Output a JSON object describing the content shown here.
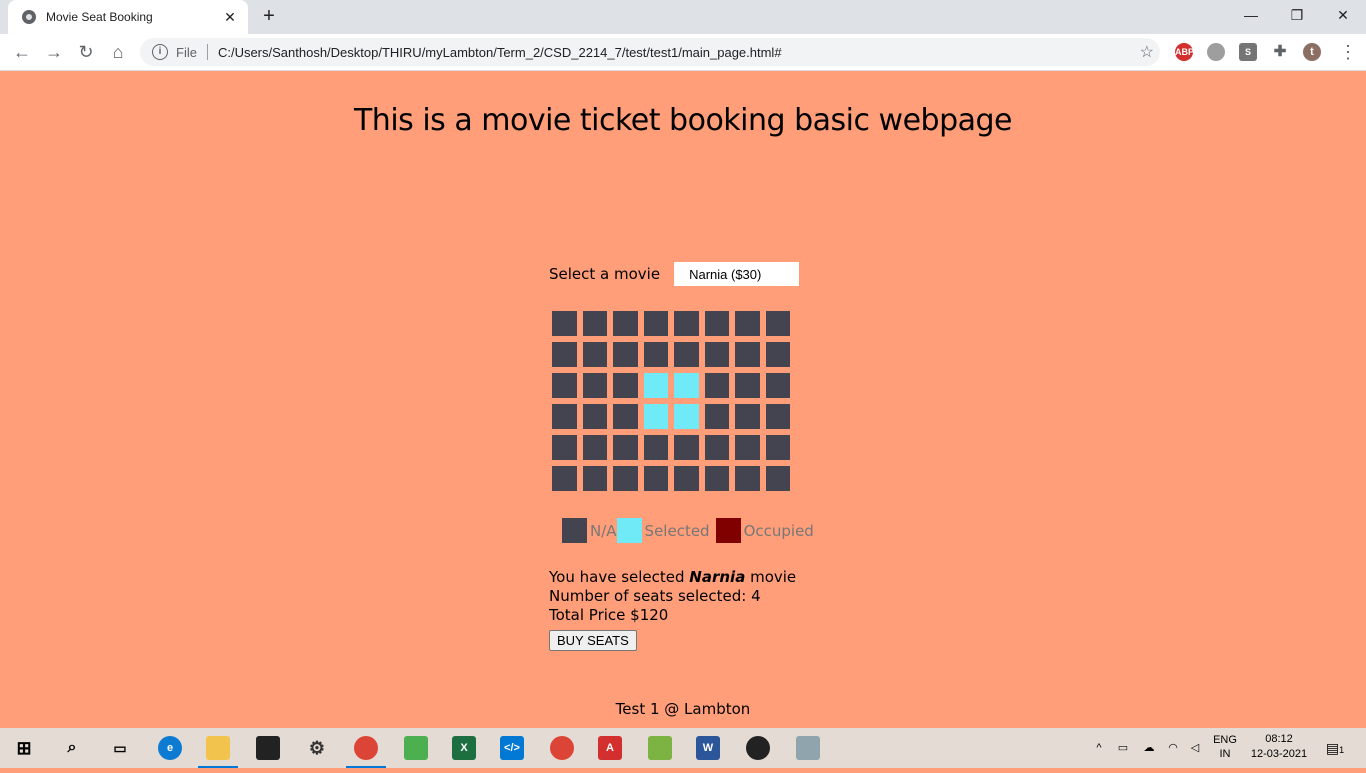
{
  "browser": {
    "tab_title": "Movie Seat Booking",
    "new_tab": "+",
    "file_label": "File",
    "url": "C:/Users/Santhosh/Desktop/THIRU/myLambton/Term_2/CSD_2214_7/test/test1/main_page.html#",
    "extensions": [
      "ABP",
      "S",
      "t"
    ]
  },
  "page": {
    "heading": "This is a movie ticket booking basic webpage",
    "select_label": "Select a movie",
    "selected_movie_option": "Narnia ($30)",
    "seats": [
      [
        "na",
        "na",
        "na",
        "na",
        "na",
        "na",
        "na",
        "na"
      ],
      [
        "na",
        "na",
        "na",
        "na",
        "na",
        "na",
        "na",
        "na"
      ],
      [
        "na",
        "na",
        "na",
        "selected",
        "selected",
        "na",
        "na",
        "na"
      ],
      [
        "na",
        "na",
        "na",
        "selected",
        "selected",
        "na",
        "na",
        "na"
      ],
      [
        "na",
        "na",
        "na",
        "na",
        "na",
        "na",
        "na",
        "na"
      ],
      [
        "na",
        "na",
        "na",
        "na",
        "na",
        "na",
        "na",
        "na"
      ]
    ],
    "legend": {
      "na": "N/A",
      "selected": "Selected",
      "occupied": "Occupied"
    },
    "summary": {
      "prefix": "You have selected",
      "movie": "Narnia",
      "suffix": "movie",
      "seats_text": "Number of seats selected: 4",
      "price_text": "Total Price $120"
    },
    "buy_button": "BUY SEATS",
    "footer": "Test 1 @ Lambton"
  },
  "colors": {
    "background": "#ff9e79",
    "seat_na": "#444451",
    "seat_selected": "#6feaf6",
    "seat_occupied": "#800000"
  },
  "taskbar": {
    "lang_1": "ENG",
    "lang_2": "IN",
    "time": "08:12",
    "date": "12-03-2021",
    "notification_count": "1"
  }
}
